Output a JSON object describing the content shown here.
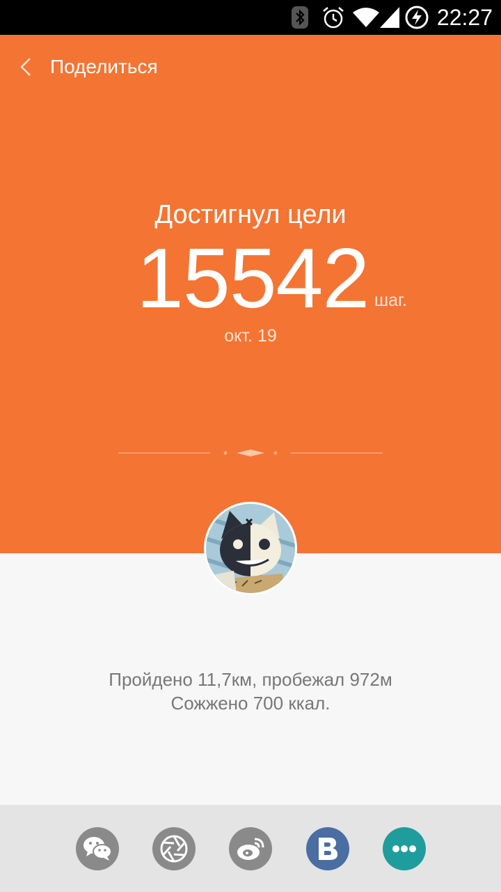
{
  "status_bar": {
    "time": "22:27"
  },
  "header": {
    "title": "Поделиться"
  },
  "hero": {
    "goal_text": "Достигнул цели",
    "steps": "15542",
    "steps_unit": "шаг.",
    "date": "окт. 19"
  },
  "stats": {
    "line1": "Пройдено 11,7км, пробежал 972м",
    "line2": "Сожжено 700 ккал."
  },
  "share_buttons": [
    {
      "icon": "wechat-icon",
      "color": "#8a8a8a"
    },
    {
      "icon": "moments-icon",
      "color": "#8a8a8a"
    },
    {
      "icon": "weibo-icon",
      "color": "#8a8a8a"
    },
    {
      "icon": "vk-icon",
      "color": "#4a6ea2"
    },
    {
      "icon": "more-icon",
      "color": "#1f9d9d"
    }
  ],
  "colors": {
    "accent": "#f47433",
    "background": "#f7f7f7",
    "bottom_bar": "#e4e4e4"
  }
}
